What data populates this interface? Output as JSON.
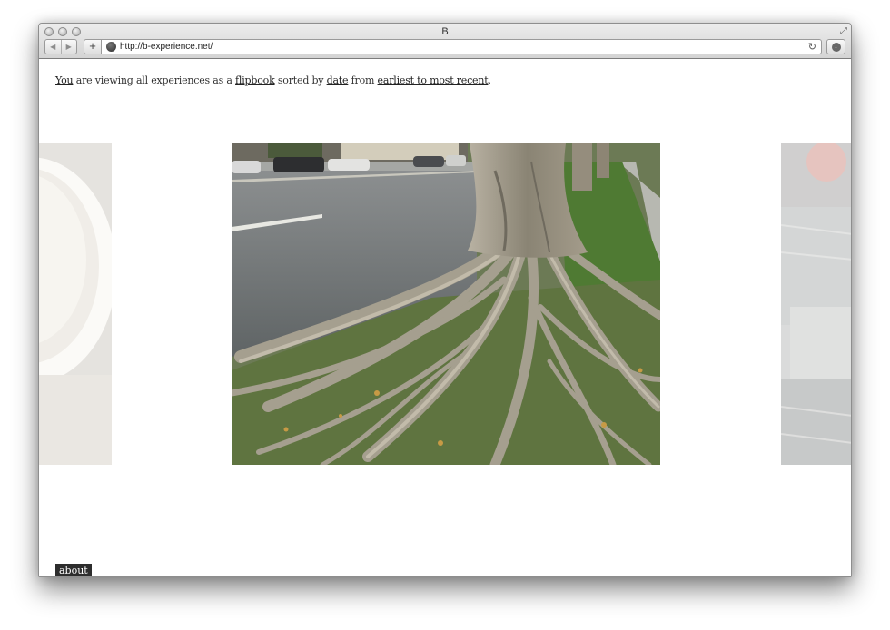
{
  "window": {
    "title": "B",
    "url": "http://b-experience.net/"
  },
  "intro": {
    "you": "You",
    "t1": " are viewing all experiences as a ",
    "flipbook": "flipbook",
    "t2": " sorted by ",
    "date": "date",
    "t3": " from ",
    "order": "earliest to most recent",
    "t4": "."
  },
  "footer": {
    "about": "about"
  },
  "icons": {
    "back": "back-arrow-icon",
    "forward": "forward-arrow-icon",
    "add": "plus-icon",
    "site": "globe-icon",
    "reload": "reload-icon",
    "download": "download-icon",
    "fullscreen": "fullscreen-icon"
  },
  "colors": {
    "about_tab": "#2d2d2d",
    "link_text": "#222222"
  }
}
